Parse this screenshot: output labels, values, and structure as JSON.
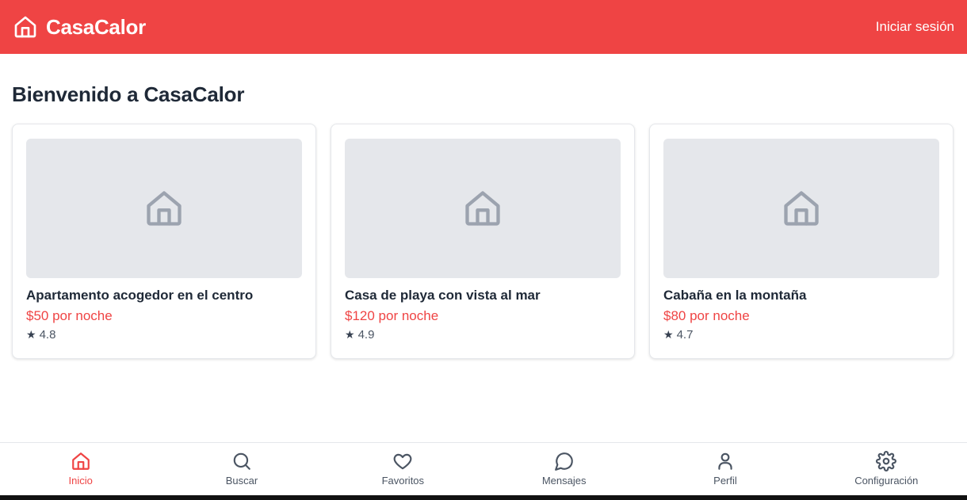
{
  "header": {
    "brand_name": "CasaCalor",
    "login_label": "Iniciar sesión",
    "accent_color": "#ef4444"
  },
  "main": {
    "title": "Bienvenido a CasaCalor",
    "listings": [
      {
        "title": "Apartamento acogedor en el centro",
        "price": "$50 por noche",
        "rating": "4.8",
        "image_icon": "house-icon"
      },
      {
        "title": "Casa de playa con vista al mar",
        "price": "$120 por noche",
        "rating": "4.9",
        "image_icon": "house-icon"
      },
      {
        "title": "Cabaña en la montaña",
        "price": "$80 por noche",
        "rating": "4.7",
        "image_icon": "house-icon"
      }
    ],
    "rating_icon": "★"
  },
  "bottom_nav": {
    "items": [
      {
        "label": "Inicio",
        "icon": "home-icon",
        "active": true
      },
      {
        "label": "Buscar",
        "icon": "search-icon",
        "active": false
      },
      {
        "label": "Favoritos",
        "icon": "heart-icon",
        "active": false
      },
      {
        "label": "Mensajes",
        "icon": "message-icon",
        "active": false
      },
      {
        "label": "Perfil",
        "icon": "user-icon",
        "active": false
      },
      {
        "label": "Configuración",
        "icon": "gear-icon",
        "active": false
      }
    ]
  }
}
